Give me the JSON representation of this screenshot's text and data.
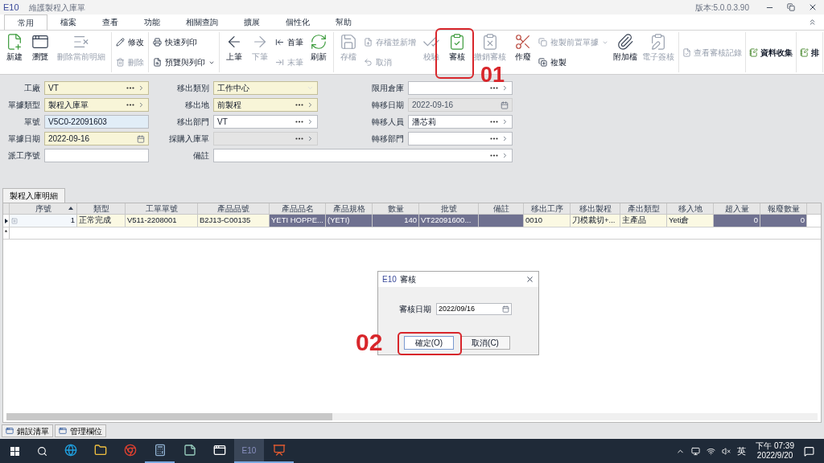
{
  "window": {
    "logo": "E10",
    "title": "維護製程入庫單",
    "version": "版本:5.0.0.3.90"
  },
  "ribbon_tabs": [
    {
      "label": "常用",
      "selected": true
    },
    {
      "label": "檔案",
      "selected": false
    },
    {
      "label": "查看",
      "selected": false
    },
    {
      "label": "功能",
      "selected": false
    },
    {
      "label": "相關查詢",
      "selected": false
    },
    {
      "label": "擴展",
      "selected": false
    },
    {
      "label": "個性化",
      "selected": false
    },
    {
      "label": "幫助",
      "selected": false
    }
  ],
  "ribbon_groups": [
    {
      "items": [
        {
          "kind": "large",
          "label": "新建",
          "disabled": false
        },
        {
          "kind": "large",
          "label": "瀏覽",
          "disabled": false
        },
        {
          "kind": "large",
          "label": "刪除當前明細",
          "disabled": true
        }
      ]
    },
    {
      "items": [
        {
          "kind": "stack",
          "entries": [
            {
              "label": "修改",
              "disabled": false,
              "dropdown": false
            },
            {
              "label": "刪除",
              "disabled": true,
              "dropdown": false
            }
          ]
        }
      ]
    },
    {
      "items": [
        {
          "kind": "stack",
          "entries": [
            {
              "label": "快速列印",
              "disabled": false,
              "dropdown": false
            },
            {
              "label": "預覽與列印",
              "disabled": false,
              "dropdown": true
            }
          ]
        }
      ]
    },
    {
      "items": [
        {
          "kind": "large",
          "label": "上筆",
          "disabled": false
        },
        {
          "kind": "large",
          "label": "下筆",
          "disabled": true
        },
        {
          "kind": "stack",
          "entries": [
            {
              "label": "首筆",
              "disabled": false,
              "dropdown": false
            },
            {
              "label": "末筆",
              "disabled": true,
              "dropdown": false
            }
          ]
        },
        {
          "kind": "large",
          "label": "刷新",
          "disabled": false
        }
      ]
    },
    {
      "items": [
        {
          "kind": "large",
          "label": "存檔",
          "disabled": true
        },
        {
          "kind": "stack",
          "entries": [
            {
              "label": "存檔並新增",
              "disabled": true,
              "dropdown": false
            },
            {
              "label": "取消",
              "disabled": true,
              "dropdown": false
            }
          ]
        },
        {
          "kind": "large",
          "label": "校驗",
          "disabled": true
        },
        {
          "kind": "large",
          "label": "審核",
          "disabled": false
        },
        {
          "kind": "large",
          "label": "撤銷審核",
          "disabled": true
        },
        {
          "kind": "large",
          "label": "作廢",
          "disabled": false
        },
        {
          "kind": "stack",
          "entries": [
            {
              "label": "複製前置單據",
              "disabled": true,
              "dropdown": true
            },
            {
              "label": "複製",
              "disabled": false,
              "dropdown": false
            }
          ]
        },
        {
          "kind": "large",
          "label": "附加檔",
          "disabled": false
        },
        {
          "kind": "large",
          "label": "電子簽核",
          "disabled": true
        }
      ]
    },
    {
      "items": [
        {
          "kind": "small",
          "label": "查看審核記錄",
          "disabled": true
        }
      ]
    },
    {
      "items": [
        {
          "kind": "small",
          "label": "資料收集",
          "disabled": false
        }
      ]
    },
    {
      "items": [
        {
          "kind": "small",
          "label": "排",
          "disabled": false
        }
      ]
    }
  ],
  "form_rows": [
    [
      {
        "label": "工廠",
        "value": "VT",
        "required": true,
        "readonly": false,
        "disabled": false,
        "kind": "lookup"
      },
      {
        "label": "移出類別",
        "value": "工作中心",
        "required": true,
        "readonly": false,
        "disabled": false,
        "kind": "select"
      },
      {
        "label": "限用倉庫",
        "required": false,
        "readonly": false,
        "disabled": false,
        "kind": "lookup"
      }
    ],
    [
      {
        "label": "單據類型",
        "value": "製程入庫單",
        "required": true,
        "readonly": false,
        "disabled": false,
        "kind": "lookup"
      },
      {
        "label": "移出地",
        "value": "前製程",
        "required": true,
        "readonly": false,
        "disabled": false,
        "kind": "lookup"
      },
      {
        "label": "轉移日期",
        "value": "2022-09-16",
        "required": false,
        "readonly": false,
        "disabled": true,
        "kind": "date"
      }
    ],
    [
      {
        "label": "單號",
        "value": "V5C0-22091603",
        "required": false,
        "readonly": true,
        "disabled": false,
        "kind": "text"
      },
      {
        "label": "移出部門",
        "value": "VT",
        "required": false,
        "readonly": false,
        "disabled": false,
        "kind": "lookup"
      },
      {
        "label": "轉移人員",
        "value": "潘芯莉",
        "required": false,
        "readonly": false,
        "disabled": false,
        "kind": "lookup"
      }
    ],
    [
      {
        "label": "單據日期",
        "value": "2022-09-16",
        "required": true,
        "readonly": false,
        "disabled": false,
        "kind": "date"
      },
      {
        "label": "採購入庫單",
        "required": false,
        "readonly": false,
        "disabled": true,
        "kind": "lookup"
      },
      {
        "label": "轉移部門",
        "required": false,
        "readonly": false,
        "disabled": false,
        "kind": "lookup"
      }
    ],
    [
      {
        "label": "派工序號",
        "required": false,
        "readonly": false,
        "disabled": false,
        "kind": "text"
      },
      {
        "label": "備註",
        "required": false,
        "readonly": false,
        "disabled": false,
        "kind": "lookup"
      }
    ]
  ],
  "detail_tab": {
    "label": "製程入庫明細",
    "selected": true
  },
  "grid": {
    "columns": [
      {
        "label": "序號",
        "kind": "number",
        "shaded": false,
        "sorted": true
      },
      {
        "label": "類型",
        "kind": "text",
        "shaded": false,
        "sorted": false
      },
      {
        "label": "工單單號",
        "kind": "text",
        "shaded": false,
        "sorted": false
      },
      {
        "label": "產品品號",
        "kind": "text",
        "shaded": false,
        "sorted": false
      },
      {
        "label": "產品品名",
        "kind": "text",
        "shaded": true,
        "sorted": false
      },
      {
        "label": "產品規格",
        "kind": "text",
        "shaded": true,
        "sorted": false
      },
      {
        "label": "數量",
        "kind": "number",
        "shaded": true,
        "sorted": false
      },
      {
        "label": "批號",
        "kind": "text",
        "shaded": true,
        "sorted": false
      },
      {
        "label": "備註",
        "kind": "text",
        "shaded": true,
        "sorted": false
      },
      {
        "label": "移出工序",
        "kind": "text",
        "shaded": false,
        "sorted": false
      },
      {
        "label": "移出製程",
        "kind": "text",
        "shaded": false,
        "sorted": false
      },
      {
        "label": "產出類型",
        "kind": "text",
        "shaded": false,
        "sorted": false
      },
      {
        "label": "移入地",
        "kind": "text",
        "shaded": false,
        "sorted": false
      },
      {
        "label": "超入量",
        "kind": "number",
        "shaded": true,
        "sorted": false
      },
      {
        "label": "報廢數量",
        "kind": "number",
        "shaded": true,
        "sorted": false
      }
    ],
    "rows": [
      {
        "current": true,
        "expandable": true,
        "cells": [
          "1",
          "正常完成",
          "V511-2208001",
          "B2J13-C00135",
          "YETI HOPPE...",
          "(YETI)",
          "140",
          "VT22091600...",
          null,
          "0010",
          "刀模裁切+...",
          "主產品",
          "Yeti倉",
          "0",
          "0"
        ]
      }
    ],
    "new_row_marker": "*"
  },
  "bottom_tabs": [
    {
      "label": "錯誤清單",
      "selected": false
    },
    {
      "label": "管理欄位",
      "selected": false
    }
  ],
  "dialog": {
    "logo": "E10",
    "title": "審核",
    "field_label": "審核日期",
    "field_value": "2022/09/16",
    "buttons": [
      {
        "label": "確定(O)",
        "default": true
      },
      {
        "label": "取消(C)",
        "default": false
      }
    ]
  },
  "annotations": [
    {
      "text": "01"
    },
    {
      "text": "02"
    }
  ],
  "taskbar": {
    "apps": [
      {
        "running": false,
        "selected": false
      },
      {
        "running": false,
        "selected": false
      },
      {
        "running": false,
        "selected": false
      },
      {
        "running": true,
        "selected": false
      },
      {
        "running": false,
        "selected": false
      },
      {
        "running": false,
        "selected": false
      },
      {
        "label": "E10",
        "running": true,
        "selected": true
      },
      {
        "running": true,
        "selected": false
      }
    ],
    "ime": "英",
    "time": "下午 07:39",
    "date": "2022/9/20"
  }
}
